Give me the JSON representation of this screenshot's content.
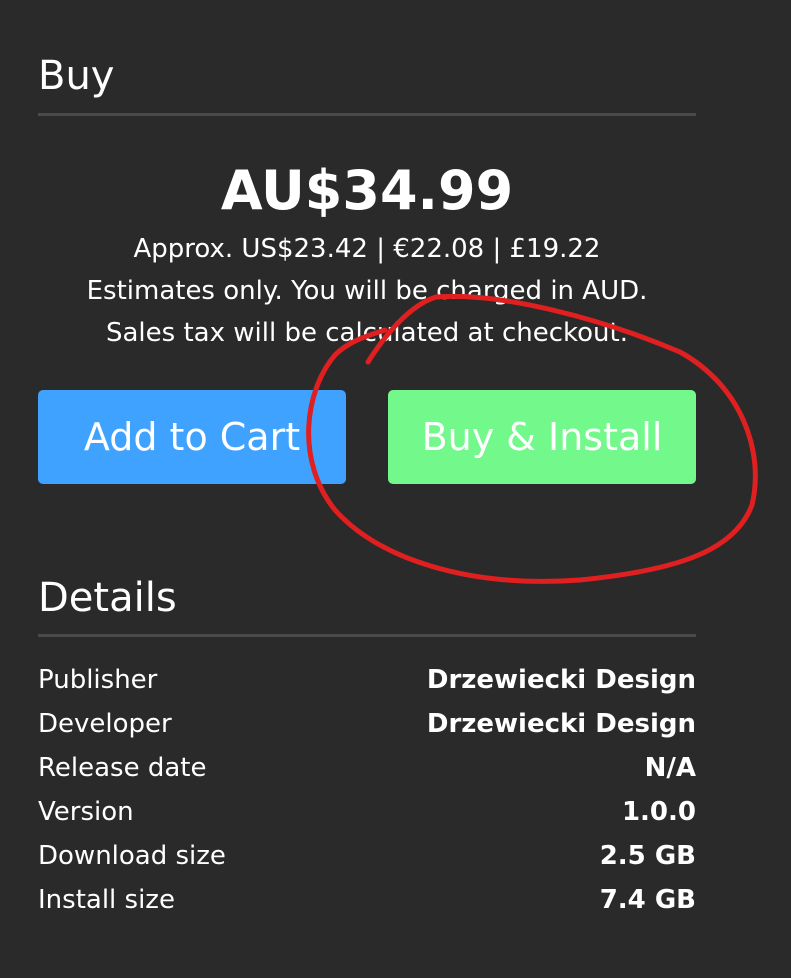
{
  "buy": {
    "title": "Buy",
    "price": "AU$34.99",
    "approx": "Approx. US$23.42 | €22.08 | £19.22",
    "estimate_note": "Estimates only. You will be charged in AUD.",
    "tax_note": "Sales tax will be calculated at checkout.",
    "add_to_cart_label": "Add to Cart",
    "buy_install_label": "Buy & Install"
  },
  "details": {
    "title": "Details",
    "rows": [
      {
        "label": "Publisher",
        "value": "Drzewiecki Design"
      },
      {
        "label": "Developer",
        "value": "Drzewiecki Design"
      },
      {
        "label": "Release date",
        "value": "N/A"
      },
      {
        "label": "Version",
        "value": "1.0.0"
      },
      {
        "label": "Download size",
        "value": "2.5 GB"
      },
      {
        "label": "Install size",
        "value": "7.4 GB"
      }
    ]
  },
  "colors": {
    "background": "#2a2a2a",
    "add_to_cart": "#3fa2ff",
    "buy_install": "#73f88b",
    "annotation": "#e02020"
  }
}
